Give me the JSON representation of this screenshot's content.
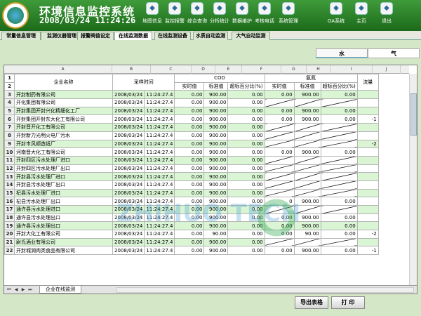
{
  "header": {
    "title": "环境信息监控系统",
    "datetime": "2008/03/24  11:24:26",
    "toolbar": [
      {
        "label": "地图信息",
        "icon": "map-icon"
      },
      {
        "label": "监控报警",
        "icon": "alarm-icon"
      },
      {
        "label": "综合查询",
        "icon": "search-icon"
      },
      {
        "label": "分析统计",
        "icon": "chart-icon"
      },
      {
        "label": "数据维护",
        "icon": "database-icon"
      },
      {
        "label": "考核电话",
        "icon": "phone-icon"
      },
      {
        "label": "系统管理",
        "icon": "tools-icon"
      },
      {
        "label": "OA系统",
        "icon": "monitor-icon"
      },
      {
        "label": "主页",
        "icon": "home-icon"
      },
      {
        "label": "退出",
        "icon": "exit-icon"
      }
    ]
  },
  "nav": [
    "常量信息管理",
    "监测仪器管理",
    "报警阀值设定",
    "在线监测数据",
    "在线监测设备",
    "水质自动监测",
    "大气自动监测"
  ],
  "nav_active": 3,
  "subtabs": [
    "水",
    "气"
  ],
  "columns": [
    "A",
    "B",
    "C",
    "D",
    "E",
    "F",
    "G",
    "H",
    "I",
    "J"
  ],
  "headers": {
    "company": "企业名称",
    "sample_time": "采样时间",
    "cod": "COD",
    "ammonia": "氨氮",
    "flow": "流量",
    "sub": [
      "实时值",
      "标准值",
      "超标百分比(%)"
    ]
  },
  "rows": [
    {
      "n": "3",
      "name": "开封制药有限公司",
      "date": "2008/03/24",
      "time": "11:24:27.4",
      "cod": [
        "0.00",
        "900.00",
        "0.00"
      ],
      "nh": [
        "0.00",
        "900.00",
        "0.00"
      ],
      "x": ""
    },
    {
      "n": "4",
      "name": "开化集团有限公司",
      "date": "2008/03/24",
      "time": "11:24:27.4",
      "cod": [
        "0.00",
        "900.00",
        "0.00"
      ],
      "nh": [
        "X",
        "X",
        "X"
      ],
      "x": ""
    },
    {
      "n": "5",
      "name": "开封集团开封兴化精细化工厂",
      "date": "2008/03/24",
      "time": "11:24:27.4",
      "cod": [
        "0.00",
        "900.00",
        "0.00"
      ],
      "nh": [
        "0.00",
        "900.00",
        "0.00"
      ],
      "x": ""
    },
    {
      "n": "6",
      "name": "开封集团开封东大化工有限公司",
      "date": "2008/03/24",
      "time": "11:24:27.4",
      "cod": [
        "0.00",
        "900.00",
        "0.00"
      ],
      "nh": [
        "0.00",
        "900.00",
        "0.00"
      ],
      "x": "-1"
    },
    {
      "n": "7",
      "name": "开封晋开化工有限公司",
      "date": "2008/03/24",
      "time": "11:24:27.4",
      "cod": [
        "0.00",
        "900.00",
        "0.00"
      ],
      "nh": [
        "X",
        "X",
        "X"
      ],
      "x": ""
    },
    {
      "n": "8",
      "name": "开封新力光明火电厂污水",
      "date": "2008/03/24",
      "time": "11:24:27.4",
      "cod": [
        "0.00",
        "900.00",
        "0.00"
      ],
      "nh": [
        "X",
        "X",
        "X"
      ],
      "x": ""
    },
    {
      "n": "9",
      "name": "开封市风顺造纸厂",
      "date": "2008/03/24",
      "time": "11:24:27.4",
      "cod": [
        "0.00",
        "900.00",
        "0.00"
      ],
      "nh": [
        "X",
        "X",
        "X"
      ],
      "x": "-2"
    },
    {
      "n": "10",
      "name": "河南晋大化工有限公司",
      "date": "2008/03/24",
      "time": "11:24:27.4",
      "cod": [
        "0.00",
        "900.00",
        "0.00"
      ],
      "nh": [
        "0.00",
        "900.00",
        "0.00"
      ],
      "x": ""
    },
    {
      "n": "11",
      "name": "开封四区污水处理厂进口",
      "date": "2008/03/24",
      "time": "11:24:27.4",
      "cod": [
        "0.00",
        "900.00",
        "0.00"
      ],
      "nh": [
        "X",
        "X",
        "X"
      ],
      "x": ""
    },
    {
      "n": "12",
      "name": "开封四区污水处理厂出口",
      "date": "2008/03/24",
      "time": "11:24:27.4",
      "cod": [
        "0.00",
        "900.00",
        "0.00"
      ],
      "nh": [
        "X",
        "X",
        "X"
      ],
      "x": ""
    },
    {
      "n": "13",
      "name": "开封县污水处理厂进口",
      "date": "2008/03/24",
      "time": "11:24:27.4",
      "cod": [
        "0.00",
        "900.00",
        "0.00"
      ],
      "nh": [
        "X",
        "X",
        "X"
      ],
      "x": ""
    },
    {
      "n": "14",
      "name": "开封县污水处理厂出口",
      "date": "2008/03/24",
      "time": "11:24:27.4",
      "cod": [
        "0.00",
        "900.00",
        "0.00"
      ],
      "nh": [
        "X",
        "X",
        "X"
      ],
      "x": ""
    },
    {
      "n": "15",
      "name": "杞县污水处理厂进口",
      "date": "2008/03/24",
      "time": "11:24:27.4",
      "cod": [
        "0.00",
        "900.00",
        "0.00"
      ],
      "nh": [
        "X",
        "X",
        "X"
      ],
      "x": ""
    },
    {
      "n": "16",
      "name": "杞县污水处理厂出口",
      "date": "2008/03/24",
      "time": "11:24:27.4",
      "cod": [
        "0.00",
        "900.00",
        "0.00"
      ],
      "nh": [
        "0",
        "900.00",
        "0.00"
      ],
      "x": ""
    },
    {
      "n": "17",
      "name": "通许县污水处理进口",
      "date": "2008/03/24",
      "time": "11:24:27.4",
      "cod": [
        "0.00",
        "900.00",
        "0.00"
      ],
      "nh": [
        "X",
        "X",
        "X"
      ],
      "x": ""
    },
    {
      "n": "18",
      "name": "通许县污水处理出口",
      "date": "2008/03/24",
      "time": "11:24:27.4",
      "cod": [
        "0.00",
        "900.00",
        "0.00"
      ],
      "nh": [
        "0.00",
        "900.00",
        "0.00"
      ],
      "x": ""
    },
    {
      "n": "19",
      "name": "通许县污水处理出口",
      "date": "2008/03/24",
      "time": "11:24:27.4",
      "cod": [
        "0.00",
        "900.00",
        "0.00"
      ],
      "nh": [
        "0.00",
        "900.00",
        "0.00"
      ],
      "x": ""
    },
    {
      "n": "20",
      "name": "开封大化工有限公司",
      "date": "2008/03/24",
      "time": "11:24:27.4",
      "cod": [
        "0.00",
        "90.00",
        "0.00"
      ],
      "nh": [
        "0.00",
        "90.00",
        "0.00"
      ],
      "x": "-2"
    },
    {
      "n": "21",
      "name": "尉氏酒业有限公司",
      "date": "2008/03/24",
      "time": "11:24:27.4",
      "cod": [
        "0.00",
        "900.00",
        "0.00"
      ],
      "nh": [
        "X",
        "X",
        "X"
      ],
      "x": ""
    },
    {
      "n": "22",
      "name": "开封城润肉类食品有限公司",
      "date": "2008/03/24",
      "time": "11:24:27.4",
      "cod": [
        "0.00",
        "900.00",
        "0.00"
      ],
      "nh": [
        "0.00",
        "900.00",
        "0.00"
      ],
      "x": "-1"
    }
  ],
  "sheet_tab": "企业在线监测",
  "buttons": {
    "export": "导出表格",
    "print": "打 印"
  },
  "watermark": "ZHIHUO TECH"
}
